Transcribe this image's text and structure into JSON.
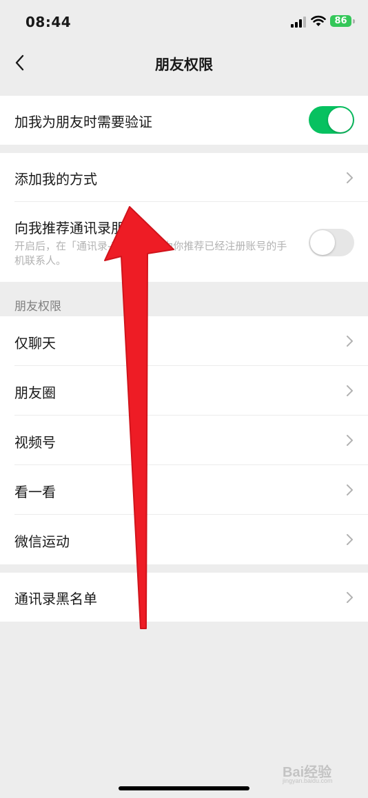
{
  "status_bar": {
    "time": "08:44",
    "battery_level": "86"
  },
  "nav": {
    "title": "朋友权限",
    "back_icon": "chevron-left-icon"
  },
  "verify": {
    "label": "加我为朋友时需要验证",
    "toggle_on": true
  },
  "add_section": {
    "add_methods_label": "添加我的方式",
    "recommend_label": "向我推荐通讯录朋友",
    "recommend_desc": "开启后，在「通讯录-新的朋友」为你推荐已经注册账号的手机联系人。",
    "recommend_toggle_on": false
  },
  "permissions": {
    "header": "朋友权限",
    "items": [
      {
        "label": "仅聊天"
      },
      {
        "label": "朋友圈"
      },
      {
        "label": "视频号"
      },
      {
        "label": "看一看"
      },
      {
        "label": "微信运动"
      }
    ]
  },
  "blacklist": {
    "label": "通讯录黑名单"
  },
  "watermark": {
    "text": "Bai经验",
    "sub": "jingyan.baidu.com"
  },
  "colors": {
    "accent_green": "#07C160",
    "annotation_red": "#EE1C25",
    "background": "#EDEDED"
  }
}
